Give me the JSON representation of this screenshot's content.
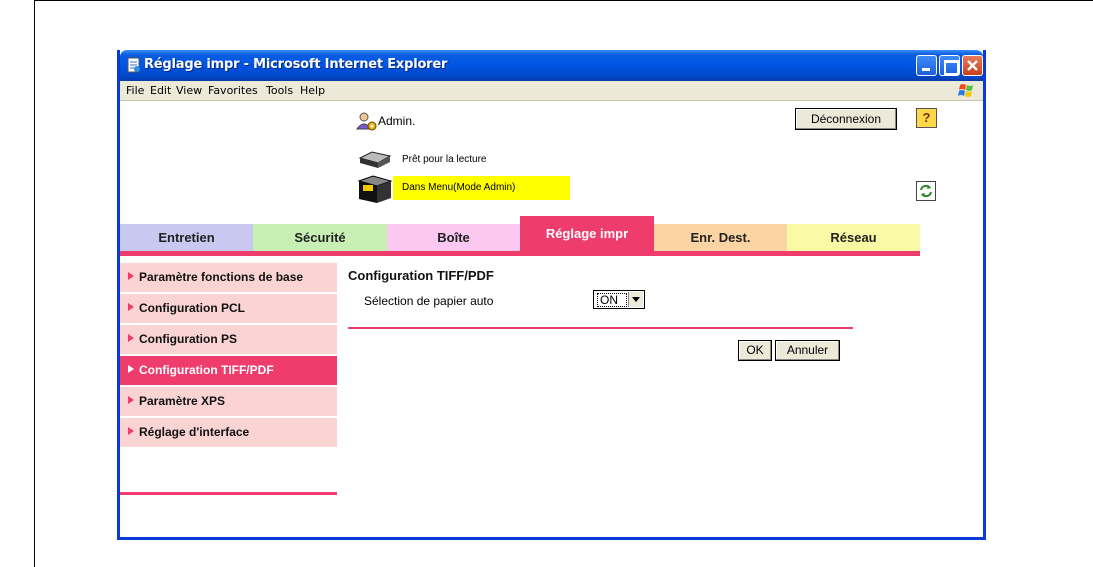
{
  "window": {
    "title": "Réglage impr - Microsoft Internet Explorer"
  },
  "menubar": {
    "items": [
      "File",
      "Edit",
      "View",
      "Favorites",
      "Tools",
      "Help"
    ]
  },
  "header": {
    "user_label": "Admin.",
    "logout_label": "Déconnexion",
    "help_label": "?",
    "status_ready": "Prêt pour la lecture",
    "status_mode": "Dans Menu(Mode Admin)"
  },
  "tabs": [
    {
      "label": "Entretien",
      "color": "#c8c8f0"
    },
    {
      "label": "Sécurité",
      "color": "#c8f0b4"
    },
    {
      "label": "Boîte",
      "color": "#fac8f0"
    },
    {
      "label": "Réglage impr",
      "color": "#ee3c6c",
      "active": true
    },
    {
      "label": "Enr. Dest.",
      "color": "#fcd4a4"
    },
    {
      "label": "Réseau",
      "color": "#fafaa4"
    }
  ],
  "sidebar": {
    "items": [
      {
        "label": "Paramètre fonctions de base"
      },
      {
        "label": "Configuration PCL"
      },
      {
        "label": "Configuration PS"
      },
      {
        "label": "Configuration TIFF/PDF",
        "active": true
      },
      {
        "label": "Paramètre XPS"
      },
      {
        "label": "Réglage d'interface"
      }
    ]
  },
  "main": {
    "title": "Configuration TIFF/PDF",
    "field_label": "Sélection de papier auto",
    "field_value": "ON",
    "ok_label": "OK",
    "cancel_label": "Annuler"
  },
  "colors": {
    "accent": "#ee3c6c",
    "sidebar_bg": "#fad3d3",
    "status_highlight": "#ffff00",
    "xp_blue": "#0054e3"
  }
}
